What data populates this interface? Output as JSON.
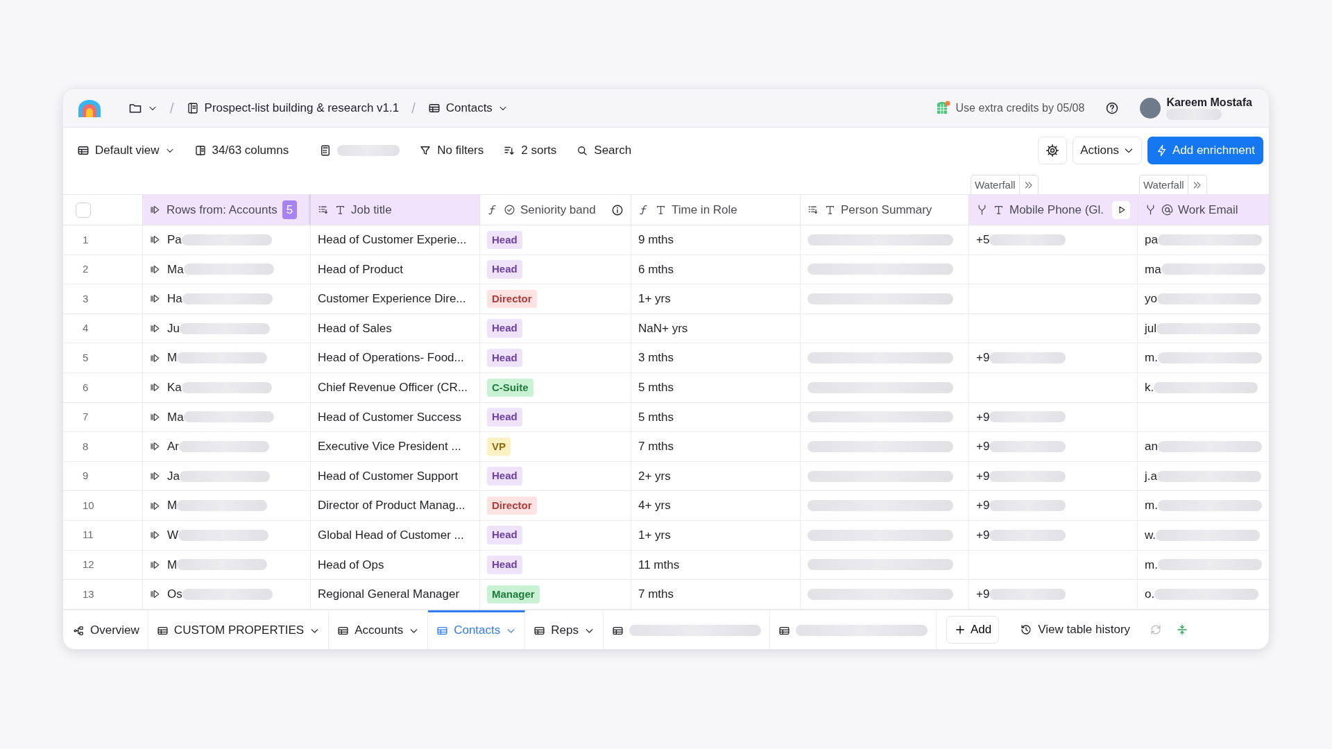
{
  "header": {
    "breadcrumb": [
      {
        "kind": "folder"
      },
      {
        "kind": "workbook",
        "label": "Prospect-list building & research v1.1"
      },
      {
        "kind": "table",
        "label": "Contacts",
        "menu": true
      }
    ],
    "separator": "/",
    "credits": "Use extra credits by 05/08",
    "user": {
      "name": "Kareem Mostafa"
    }
  },
  "toolbar": {
    "view": "Default view",
    "columns": "34/63 columns",
    "filters": "No filters",
    "sorts": "2 sorts",
    "search": "Search",
    "actions": "Actions",
    "primary": "Add enrichment"
  },
  "table": {
    "select_all": {
      "checked": false
    },
    "columns": [
      {
        "kind": "lookup",
        "label": "Rows from: Accounts",
        "count": "5",
        "highlighted": true
      },
      {
        "kind": "generated",
        "label": "Job title",
        "highlighted": true
      },
      {
        "kind": "select",
        "label": "Seniority band",
        "highlighted": false,
        "info": true
      },
      {
        "kind": "formula",
        "label": "Time in Role",
        "highlighted": false
      },
      {
        "kind": "generated",
        "label": "Person Summary",
        "highlighted": false
      },
      {
        "kind": "phone",
        "label": "Mobile Phone (Gl.",
        "highlighted": true,
        "run": true,
        "waterfall": "Waterfall"
      },
      {
        "kind": "email",
        "label": "Work Email",
        "highlighted": true,
        "waterfall": "Waterfall"
      }
    ],
    "rows": [
      {
        "num": "1",
        "name": "Pa",
        "title": "Head of Customer Experie...",
        "seniority": {
          "label": "Head",
          "color": "#efe3fb"
        },
        "time": "9 mths",
        "summary_redacted": true,
        "phone": "+5",
        "email": "pa"
      },
      {
        "num": "2",
        "name": "Ma",
        "title": "Head of Product",
        "seniority": {
          "label": "Head",
          "color": "#efe3fb"
        },
        "time": "6 mths",
        "summary_redacted": true,
        "phone": "",
        "email": "ma"
      },
      {
        "num": "3",
        "name": "Ha",
        "title": "Customer Experience Dire...",
        "seniority": {
          "label": "Director",
          "color": "#fde2e2"
        },
        "time": "1+ yrs",
        "summary_redacted": true,
        "phone": "",
        "email": "yo"
      },
      {
        "num": "4",
        "name": "Ju",
        "title": "Head of Sales",
        "seniority": {
          "label": "Head",
          "color": "#efe3fb"
        },
        "time": "NaN+ yrs",
        "summary_redacted": false,
        "phone": "",
        "email": "jul"
      },
      {
        "num": "5",
        "name": "M",
        "title": "Head of Operations- Food...",
        "seniority": {
          "label": "Head",
          "color": "#efe3fb"
        },
        "time": "3 mths",
        "summary_redacted": true,
        "phone": "+9",
        "email": "m."
      },
      {
        "num": "6",
        "name": "Ka",
        "title": "Chief Revenue Officer (CR...",
        "seniority": {
          "label": "C-Suite",
          "color": "#c8f2d3"
        },
        "time": "5 mths",
        "summary_redacted": true,
        "phone": "",
        "email": "k."
      },
      {
        "num": "7",
        "name": "Ma",
        "title": "Head of Customer Success",
        "seniority": {
          "label": "Head",
          "color": "#efe3fb"
        },
        "time": "5 mths",
        "summary_redacted": true,
        "phone": "+9",
        "email": ""
      },
      {
        "num": "8",
        "name": "Ar",
        "title": "Executive Vice President ...",
        "seniority": {
          "label": "VP",
          "color": "#fdf0c2"
        },
        "time": "7 mths",
        "summary_redacted": true,
        "phone": "+9",
        "email": "an"
      },
      {
        "num": "9",
        "name": "Ja",
        "title": "Head of Customer Support",
        "seniority": {
          "label": "Head",
          "color": "#efe3fb"
        },
        "time": "2+ yrs",
        "summary_redacted": true,
        "phone": "+9",
        "email": "j.a"
      },
      {
        "num": "10",
        "name": "M",
        "title": "Director of Product Manag...",
        "seniority": {
          "label": "Director",
          "color": "#fde2e2"
        },
        "time": "4+ yrs",
        "summary_redacted": true,
        "phone": "+9",
        "email": "m."
      },
      {
        "num": "11",
        "name": "W",
        "title": "Global Head of Customer ...",
        "seniority": {
          "label": "Head",
          "color": "#efe3fb"
        },
        "time": "1+ yrs",
        "summary_redacted": true,
        "phone": "+9",
        "email": "w."
      },
      {
        "num": "12",
        "name": "M",
        "title": "Head of Ops",
        "seniority": {
          "label": "Head",
          "color": "#efe3fb"
        },
        "time": "11 mths",
        "summary_redacted": true,
        "phone": "",
        "email": "m."
      },
      {
        "num": "13",
        "name": "Os",
        "title": "Regional General Manager",
        "seniority": {
          "label": "Manager",
          "color": "#c8f2d3"
        },
        "time": "7 mths",
        "summary_redacted": true,
        "phone": "+9",
        "email": "o."
      }
    ]
  },
  "bottom_tabs": [
    {
      "kind": "overview",
      "label": "Overview",
      "selected": false
    },
    {
      "kind": "table",
      "label": "CUSTOM PROPERTIES",
      "selected": false,
      "menu": true
    },
    {
      "kind": "table",
      "label": "Accounts",
      "selected": false,
      "menu": true
    },
    {
      "kind": "table",
      "label": "Contacts",
      "selected": true,
      "menu": true
    },
    {
      "kind": "table",
      "label": "Reps",
      "selected": false,
      "menu": true
    },
    {
      "kind": "redacted",
      "selected": false
    },
    {
      "kind": "redacted",
      "selected": false
    }
  ],
  "add": "Add",
  "history": "View table history"
}
